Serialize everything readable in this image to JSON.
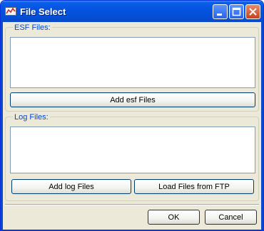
{
  "window": {
    "title": "File Select",
    "icon": "chart-icon",
    "controls": [
      "minimize-icon",
      "maximize-icon",
      "close-icon"
    ]
  },
  "esf_group": {
    "legend": "ESF Files:",
    "items": [],
    "add_button": "Add esf Files"
  },
  "log_group": {
    "legend": "Log Files:",
    "items": [],
    "add_button": "Add log Files",
    "ftp_button": "Load Files from FTP"
  },
  "footer": {
    "ok_label": "OK",
    "cancel_label": "Cancel"
  },
  "colors": {
    "titlebar": "#0553e0",
    "legend_text": "#0046d5",
    "dialog_bg": "#ece9d8"
  }
}
